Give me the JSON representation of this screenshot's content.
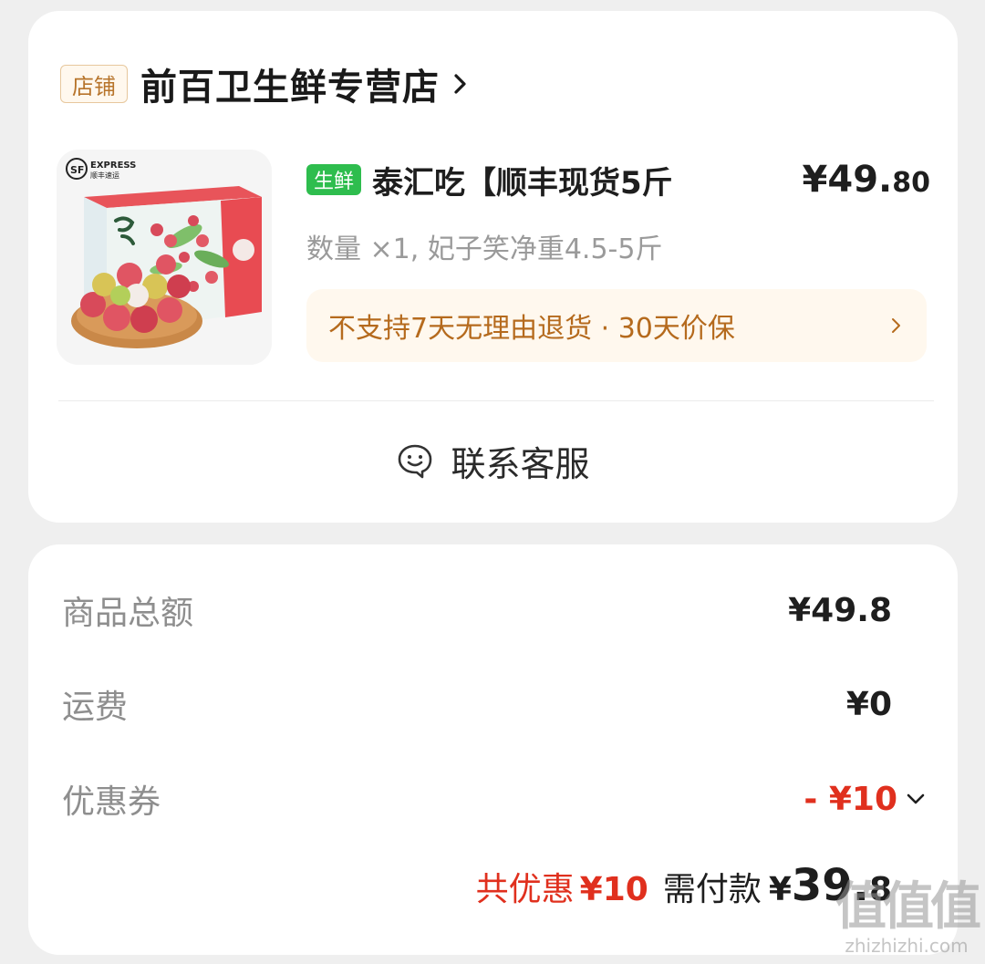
{
  "store": {
    "tag": "店铺",
    "name": "前百卫生鲜专营店"
  },
  "product": {
    "image_brand": "EXPRESS",
    "image_brand_cn": "顺丰速运",
    "badge": "生鲜",
    "title": "泰汇吃【顺丰现货5斤",
    "price_int": "¥49.",
    "price_dec": "80",
    "spec": "数量 ×1, 妃子笑净重4.5-5斤",
    "policy": "不支持7天无理由退货 · 30天价保"
  },
  "customer_service": {
    "label": "联系客服"
  },
  "summary": {
    "goods_label": "商品总额",
    "goods_value": "¥49.8",
    "shipping_label": "运费",
    "shipping_value": "¥0",
    "coupon_label": "优惠券",
    "coupon_value": "- ¥10",
    "discount_label": "共优惠",
    "discount_value": "¥10",
    "pay_label": "需付款",
    "pay_yen": "¥",
    "pay_int": "39.",
    "pay_dec": "8"
  },
  "watermark": {
    "logo": "值值值",
    "site": "zhizhizhi.com"
  },
  "colors": {
    "fresh_badge": "#2ebd4e",
    "discount_red": "#e0301e",
    "policy_orange": "#b56a1d",
    "store_tag": "#b7742b"
  }
}
